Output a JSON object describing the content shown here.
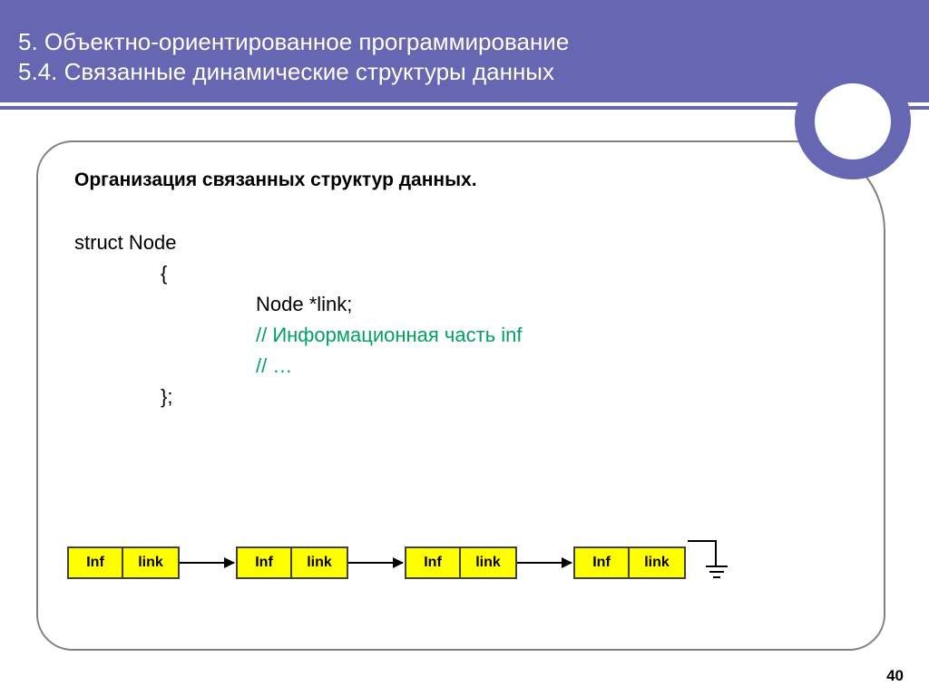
{
  "header": {
    "line1": "5. Объектно-ориентированное программирование",
    "line2": "5.4. Связанные динамические структуры данных"
  },
  "subtitle": "Организация связанных структур данных.",
  "code": {
    "l1": "struct  Node",
    "l2": "{",
    "l3": "Node *link;",
    "l4": "// Информационная часть inf",
    "l5": "// …",
    "l6": "};"
  },
  "node_labels": {
    "inf": "Inf",
    "link": "link"
  },
  "page_number": "40"
}
